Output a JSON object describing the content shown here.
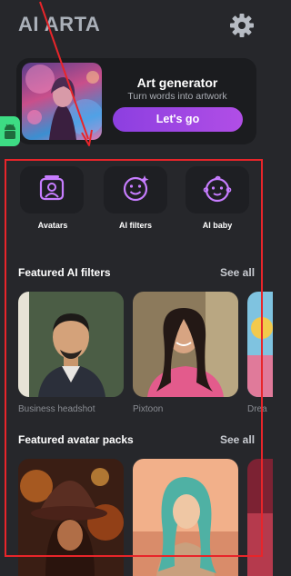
{
  "header": {
    "app_title": "AI ARTA",
    "settings_icon": "gear-icon"
  },
  "generator": {
    "title": "Art generator",
    "subtitle": "Turn words into artwork",
    "button_label": "Let's go",
    "accent": "#9b45e4"
  },
  "quick_actions": [
    {
      "label": "Avatars",
      "icon": "avatar-portrait-icon"
    },
    {
      "label": "AI filters",
      "icon": "magic-face-icon"
    },
    {
      "label": "AI baby",
      "icon": "baby-face-icon"
    }
  ],
  "featured_filters": {
    "title": "Featured AI filters",
    "see_all": "See all",
    "items": [
      {
        "caption": "Business headshot"
      },
      {
        "caption": "Pixtoon"
      },
      {
        "caption": "Drea"
      }
    ]
  },
  "featured_packs": {
    "title": "Featured avatar packs",
    "see_all": "See all"
  },
  "colors": {
    "background": "#26272b",
    "annotation_red": "#e8252a",
    "icon_purple": "#c77dff"
  }
}
